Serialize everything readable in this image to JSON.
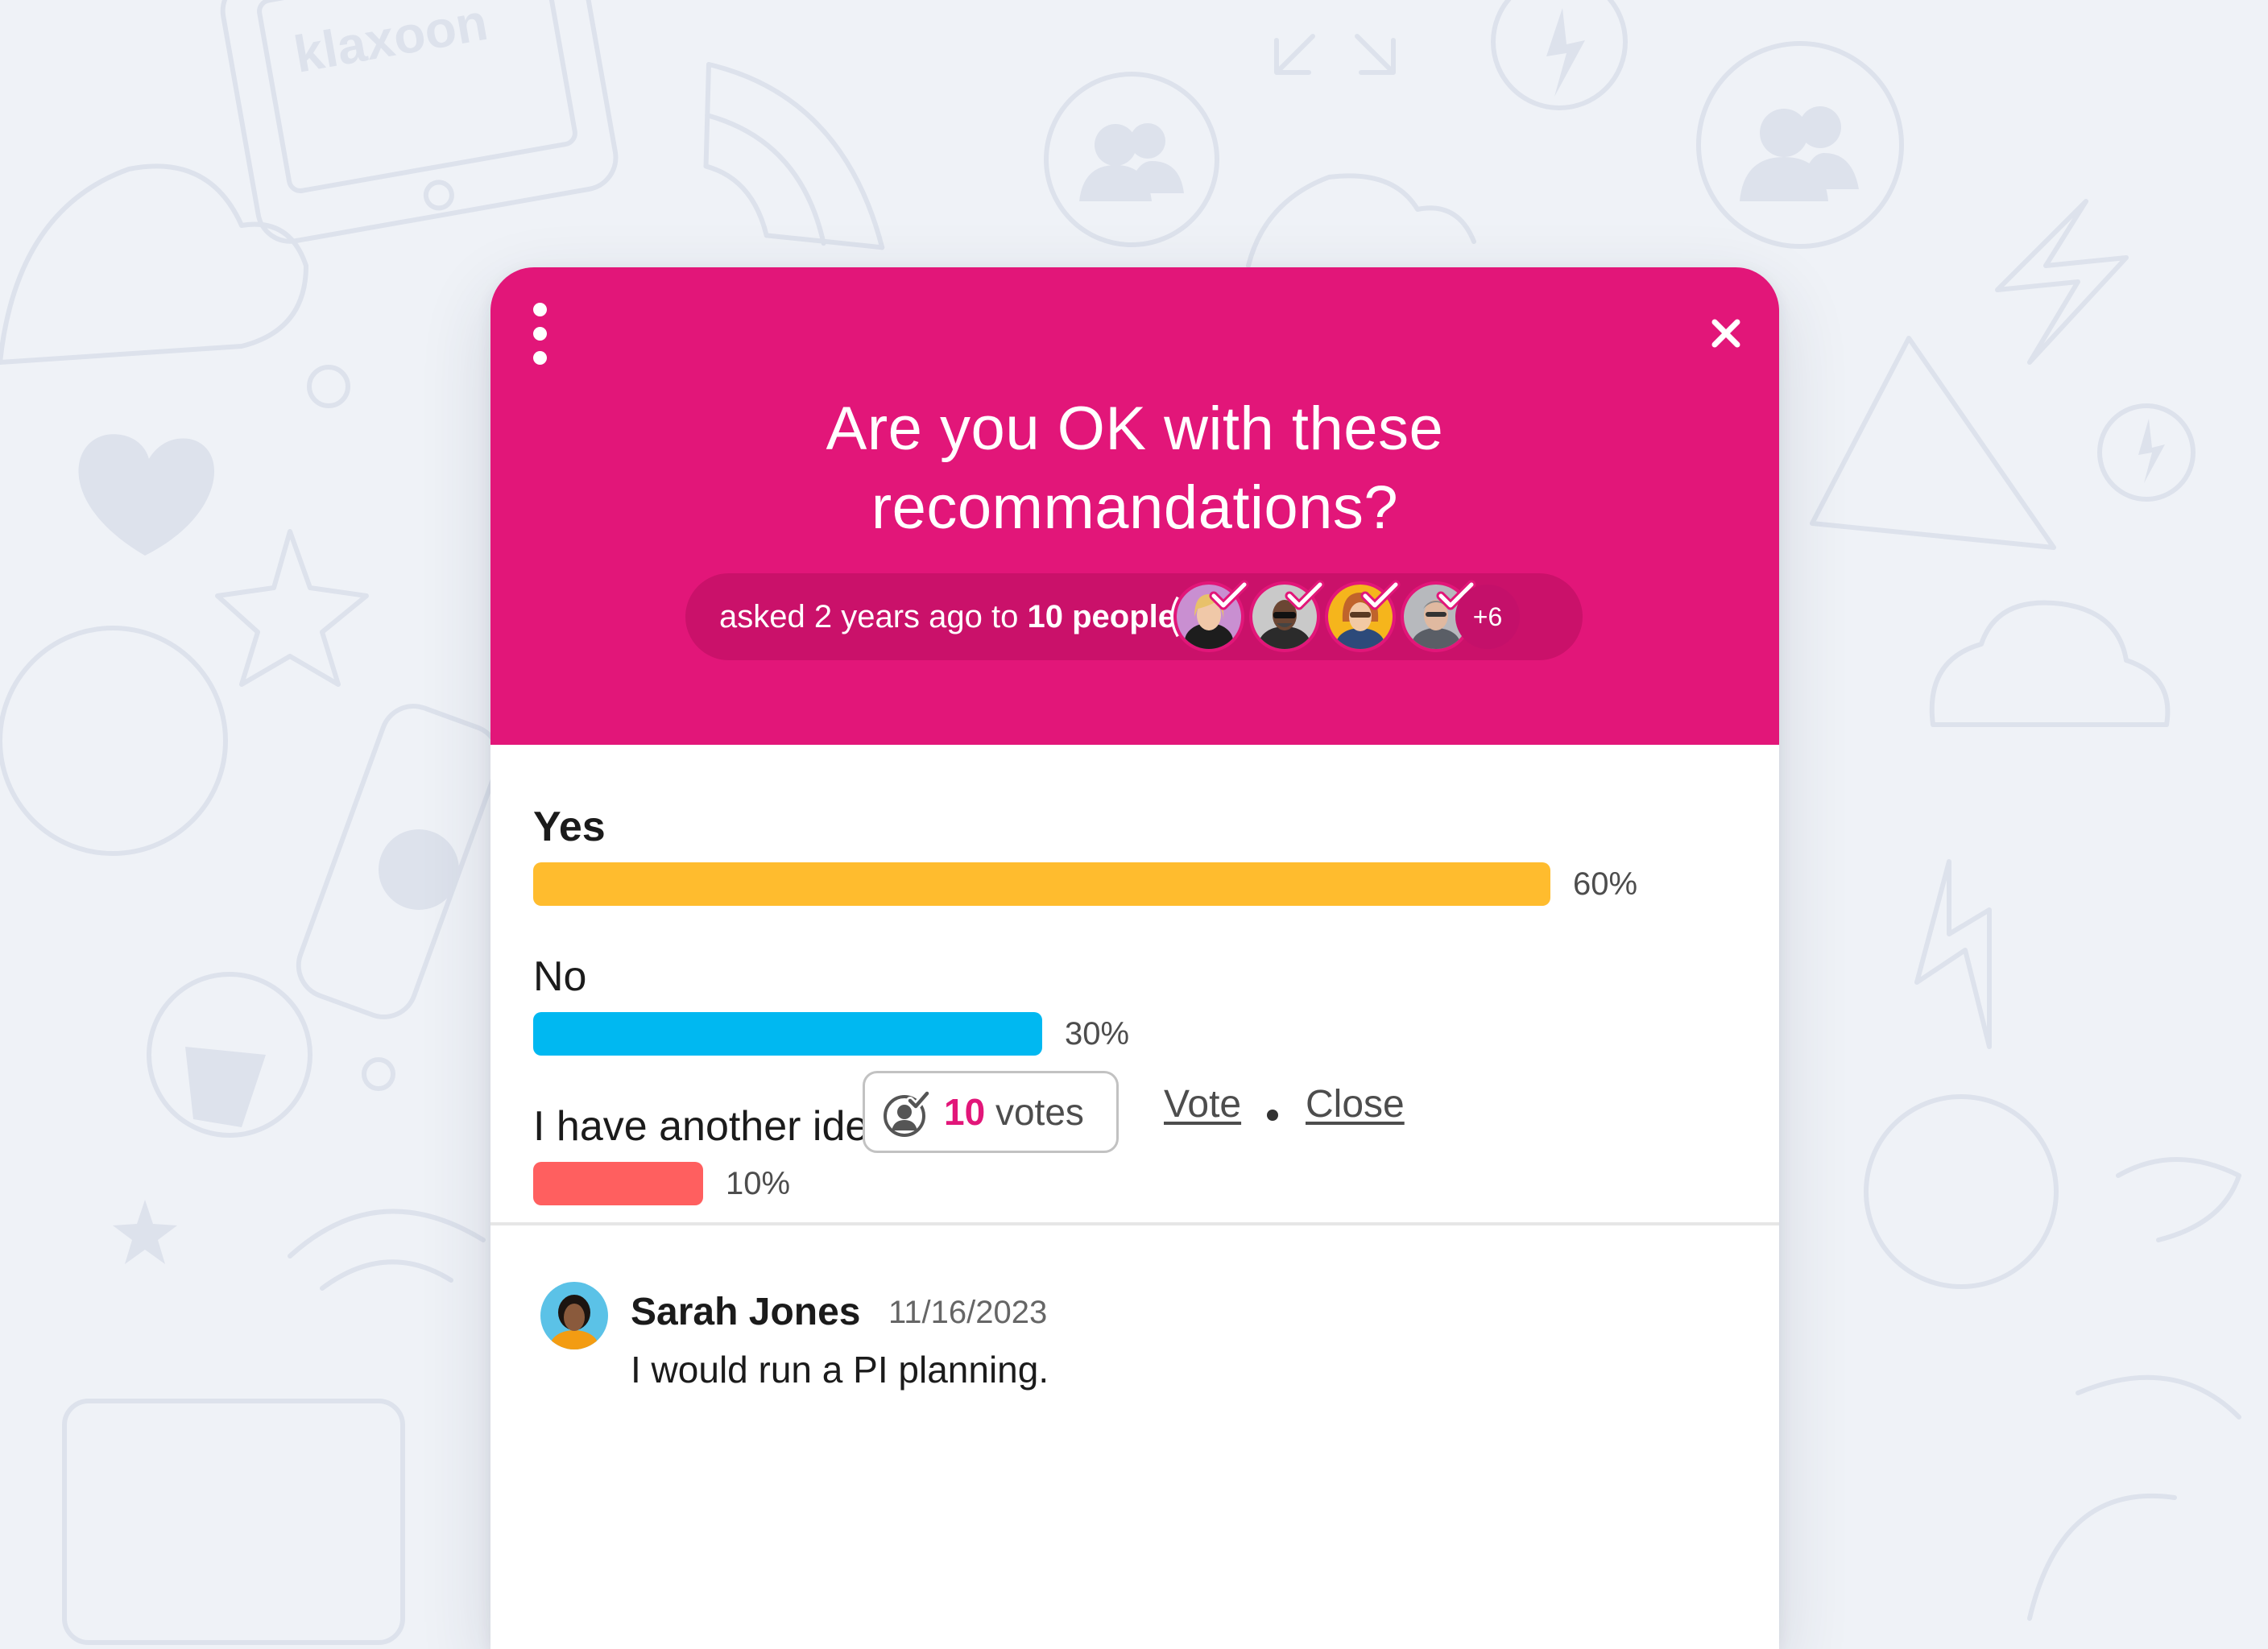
{
  "background": {
    "brand_watermark": "klaxoon"
  },
  "poll": {
    "question": "Are you OK with these recommandations?",
    "asked": {
      "prefix": "asked 2 years ago to ",
      "audience": "10 people"
    },
    "participants": [
      {
        "name": "participant-1",
        "voted": true
      },
      {
        "name": "participant-2",
        "voted": true
      },
      {
        "name": "participant-3",
        "voted": true
      },
      {
        "name": "participant-4",
        "voted": true
      }
    ],
    "more_participants": "+6",
    "options": [
      {
        "label": "Yes",
        "percent_label": "60%",
        "percent": 60,
        "color": "#ffbc2e",
        "leading": true
      },
      {
        "label": "No",
        "percent_label": "30%",
        "percent": 30,
        "color": "#00b8f1",
        "leading": false
      },
      {
        "label": "I have another idea",
        "percent_label": "10%",
        "percent": 10,
        "color": "#ff5f5f",
        "leading": false
      }
    ],
    "votes": {
      "count": "10",
      "label": " votes"
    },
    "actions": {
      "vote": "Vote",
      "close": "Close"
    }
  },
  "comment": {
    "author": "Sarah Jones",
    "date": "11/16/2023",
    "text": "I would run a PI planning."
  },
  "colors": {
    "brand": "#e21679",
    "background": "#eff2f7",
    "doodle": "#dde2ec"
  },
  "icons": {
    "menu": "kebab-menu-icon",
    "close": "close-icon",
    "votes": "voter-check-icon",
    "participant_check": "check-icon"
  }
}
